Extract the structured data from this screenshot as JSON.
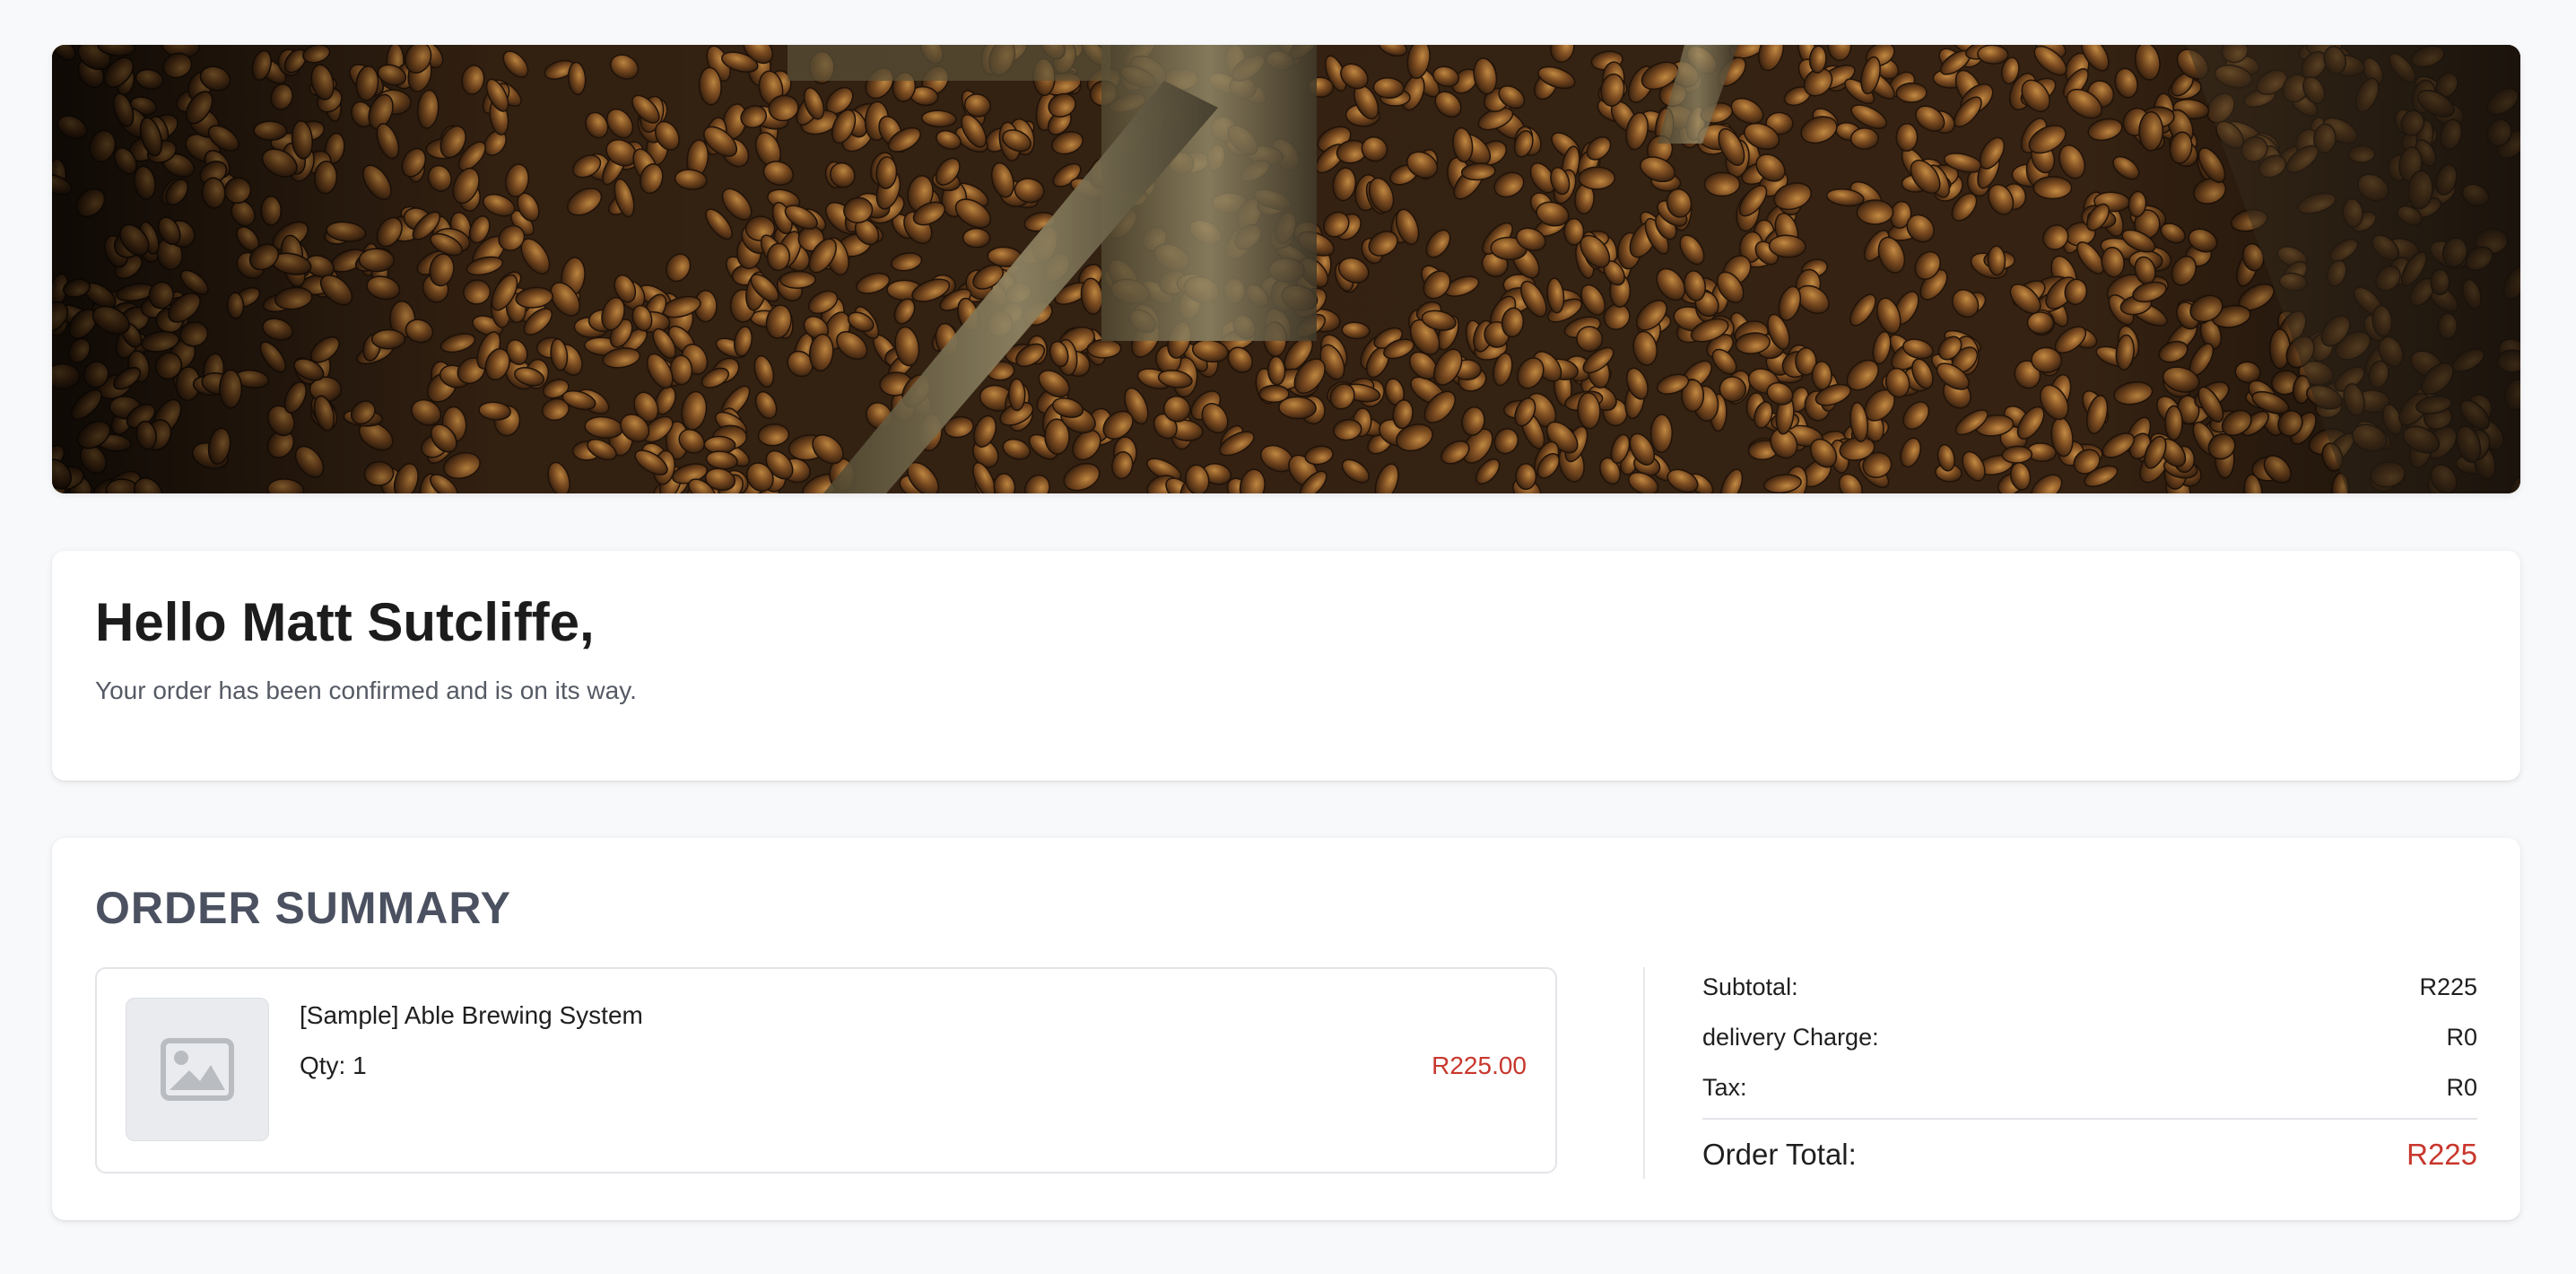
{
  "greeting": {
    "title": "Hello Matt Sutcliffe,",
    "message": "Your order has been confirmed and is on its way."
  },
  "order_summary": {
    "heading": "ORDER SUMMARY",
    "items": [
      {
        "name": "[Sample] Able Brewing System",
        "qty_label": "Qty:",
        "qty": "1",
        "price": "R225.00",
        "thumbnail_icon": "image-placeholder-icon"
      }
    ],
    "totals": {
      "subtotal_label": "Subtotal:",
      "subtotal_value": "R225",
      "delivery_label": "delivery Charge:",
      "delivery_value": "R0",
      "tax_label": "Tax:",
      "tax_value": "R0",
      "order_total_label": "Order Total:",
      "order_total_value": "R225"
    }
  },
  "colors": {
    "accent_price": "#c8372d",
    "heading_grey": "#4b5160",
    "page_bg": "#f8f9fb"
  }
}
